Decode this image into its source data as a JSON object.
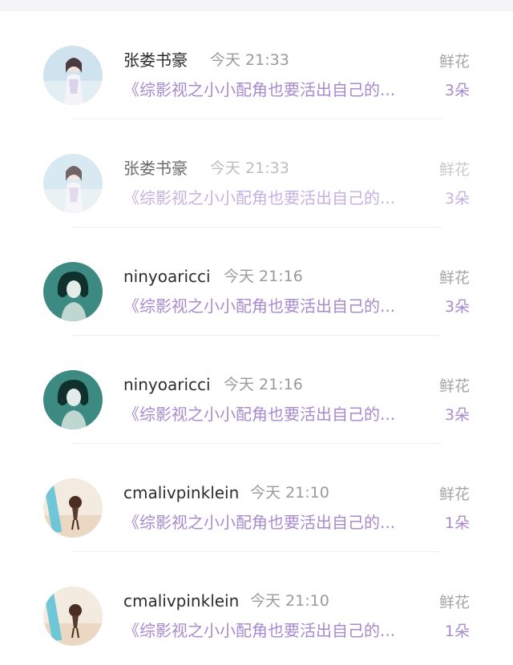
{
  "rows": [
    {
      "name": "张娄书豪",
      "time": "今天 21:33",
      "book": "《综影视之小小配角也要活出自己的...",
      "gift_label": "鲜花",
      "gift_count": "3朵",
      "avatar": "girl-portrait-avatar"
    },
    {
      "name": "张娄书豪",
      "time": "今天 21:33",
      "book": "《综影视之小小配角也要活出自己的...",
      "gift_label": "鲜花",
      "gift_count": "3朵",
      "avatar": "girl-portrait-avatar"
    },
    {
      "name": "ninyoaricci",
      "time": "今天 21:16",
      "book": "《综影视之小小配角也要活出自己的...",
      "gift_label": "鲜花",
      "gift_count": "3朵",
      "avatar": "bob-hair-avatar"
    },
    {
      "name": "ninyoaricci",
      "time": "今天 21:16",
      "book": "《综影视之小小配角也要活出自己的...",
      "gift_label": "鲜花",
      "gift_count": "3朵",
      "avatar": "bob-hair-avatar"
    },
    {
      "name": "cmalivpinklein",
      "time": "今天 21:10",
      "book": "《综影视之小小配角也要活出自己的...",
      "gift_label": "鲜花",
      "gift_count": "1朵",
      "avatar": "beach-avatar"
    },
    {
      "name": "cmalivpinklein",
      "time": "今天 21:10",
      "book": "《综影视之小小配角也要活出自己的...",
      "gift_label": "鲜花",
      "gift_count": "1朵",
      "avatar": "beach-avatar"
    }
  ]
}
